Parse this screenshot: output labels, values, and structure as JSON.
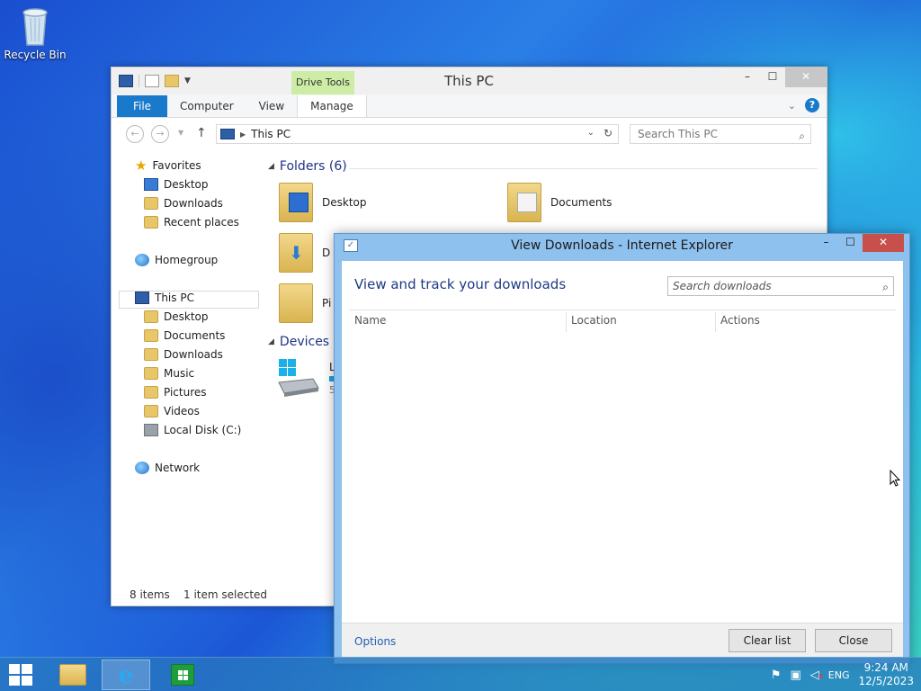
{
  "desktop": {
    "recycle_bin_label": "Recycle Bin"
  },
  "explorer": {
    "title": "This PC",
    "context_tab": "Drive Tools",
    "ribbon_tabs": [
      "File",
      "Computer",
      "View",
      "Manage"
    ],
    "address": "This PC",
    "search_placeholder": "Search This PC",
    "nav": {
      "favorites": "Favorites",
      "favorites_items": [
        "Desktop",
        "Downloads",
        "Recent places"
      ],
      "homegroup": "Homegroup",
      "this_pc": "This PC",
      "this_pc_items": [
        "Desktop",
        "Documents",
        "Downloads",
        "Music",
        "Pictures",
        "Videos",
        "Local Disk (C:)"
      ],
      "network": "Network"
    },
    "groups": {
      "folders": "Folders (6)",
      "devices": "Devices a"
    },
    "tiles": {
      "desktop": "Desktop",
      "documents": "Documents",
      "downloads_partial": "D",
      "pictures_partial": "Pi",
      "local_disk_partial": "Lo",
      "local_disk_size_partial": "50"
    },
    "status": {
      "items": "8 items",
      "selected": "1 item selected"
    }
  },
  "downloads_dialog": {
    "title": "View Downloads - Internet Explorer",
    "heading": "View and track your downloads",
    "search_placeholder": "Search downloads",
    "columns": [
      "Name",
      "Location",
      "Actions"
    ],
    "options_link": "Options",
    "clear_button": "Clear list",
    "close_button": "Close"
  },
  "taskbar": {
    "language": "ENG",
    "time": "9:24 AM",
    "date": "12/5/2023"
  },
  "colors": {
    "accent": "#1979ca",
    "drive_tools": "#cdeca5",
    "dialog_frame": "#8fc1ee",
    "close_red": "#c7504a"
  }
}
